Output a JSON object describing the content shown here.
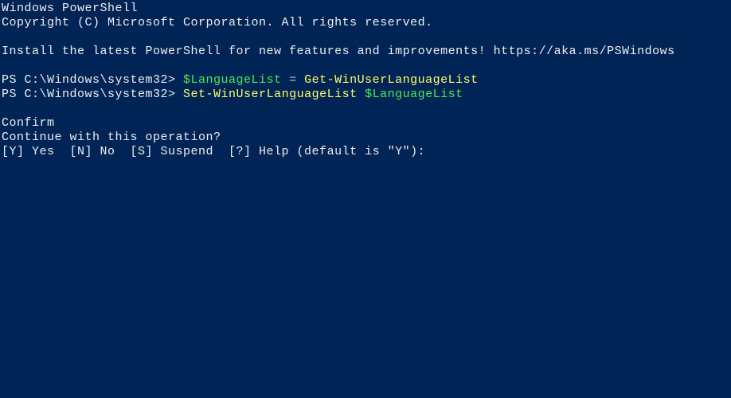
{
  "header": {
    "title": "Windows PowerShell",
    "copyright": "Copyright (C) Microsoft Corporation. All rights reserved."
  },
  "notice": {
    "text": "Install the latest PowerShell for new features and improvements! https://aka.ms/PSWindows"
  },
  "commands": [
    {
      "prompt": "PS C:\\Windows\\system32> ",
      "variable": "$LanguageList",
      "operator": " = ",
      "cmdlet": "Get-WinUserLanguageList"
    },
    {
      "prompt": "PS C:\\Windows\\system32> ",
      "cmdlet": "Set-WinUserLanguageList ",
      "variable": "$LanguageList"
    }
  ],
  "confirm": {
    "title": "Confirm",
    "question": "Continue with this operation?",
    "options": "[Y] Yes  [N] No  [S] Suspend  [?] Help (default is \"Y\"):"
  }
}
